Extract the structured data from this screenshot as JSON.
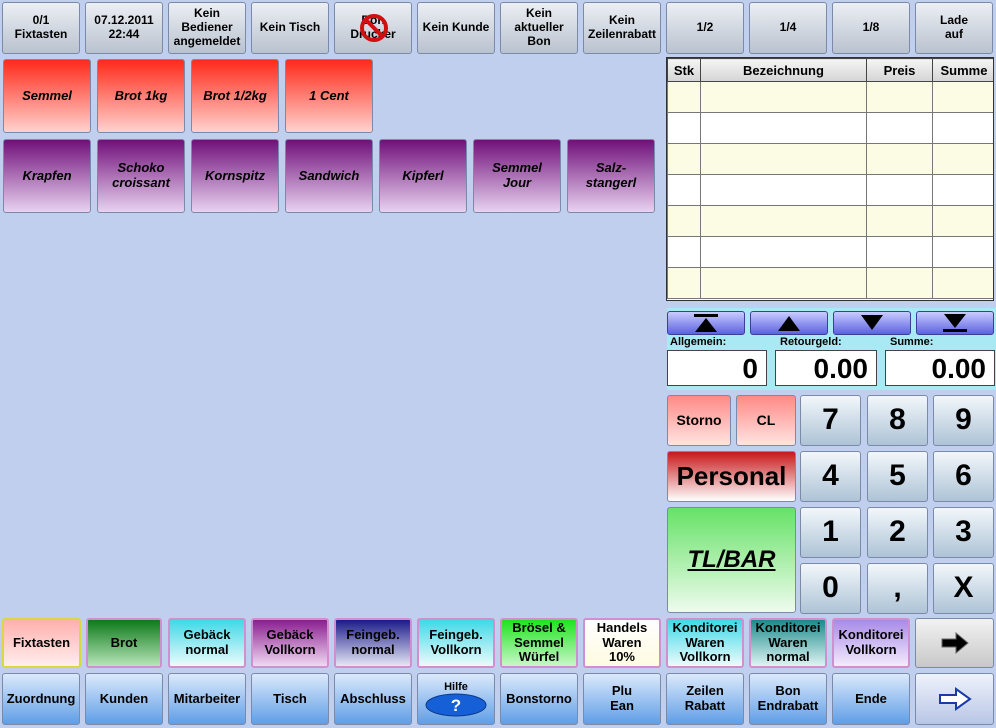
{
  "top_bar": {
    "fixtasten": "0/1\nFixtasten",
    "datetime": "07.12.2011\n22:44",
    "bediener": "Kein\nBediener\nangemeldet",
    "tisch": "Kein Tisch",
    "bon_drucker": "Bon\nDrucker",
    "kunde": "Kein Kunde",
    "aktueller_bon": "Kein\naktueller\nBon",
    "zeilenrabatt": "Kein\nZeilenrabatt",
    "half": "1/2",
    "quarter": "1/4",
    "eighth": "1/8",
    "lade": "Lade\nauf"
  },
  "products_row1": [
    "Semmel",
    "Brot 1kg",
    "Brot 1/2kg",
    "1 Cent"
  ],
  "products_row2": [
    "Krapfen",
    "Schoko\ncroissant",
    "Kornspitz",
    "Sandwich",
    "Kipferl",
    "Semmel\nJour",
    "Salz-\nstangerl"
  ],
  "receipt": {
    "headers": [
      "Stk",
      "Bezeichnung",
      "Preis",
      "Summe"
    ]
  },
  "totals": {
    "allgemein_label": "Allgemein:",
    "allgemein_value": "0",
    "retourgeld_label": "Retourgeld:",
    "retourgeld_value": "0.00",
    "summe_label": "Summe:",
    "summe_value": "0.00"
  },
  "keypad": {
    "storno": "Storno",
    "cl": "CL",
    "personal": "Personal",
    "tlbar": "TL/BAR",
    "k7": "7",
    "k8": "8",
    "k9": "9",
    "k4": "4",
    "k5": "5",
    "k6": "6",
    "k1": "1",
    "k2": "2",
    "k3": "3",
    "k0": "0",
    "comma": ",",
    "x": "X"
  },
  "categories": [
    "Fixtasten",
    "Brot",
    "Gebäck\nnormal",
    "Gebäck\nVollkorn",
    "Feingeb.\nnormal",
    "Feingeb.\nVollkorn",
    "Brösel &\nSemmel\nWürfel",
    "Handels\nWaren\n10%",
    "Konditorei\nWaren\nVollkorn",
    "Konditorei\nWaren\nnormal",
    "Konditorei\nVollkorn"
  ],
  "bottom_bar": {
    "zuordnung": "Zuordnung",
    "kunden": "Kunden",
    "mitarbeiter": "Mitarbeiter",
    "tisch": "Tisch",
    "abschluss": "Abschluss",
    "hilfe": "Hilfe",
    "bonstorno": "Bonstorno",
    "plu_ean": "Plu\nEan",
    "zeilen_rabatt": "Zeilen\nRabatt",
    "bon_endrabatt": "Bon\nEndrabatt",
    "ende": "Ende"
  },
  "colors": {
    "background": "#c0cfee",
    "product_red": "#ff2a1a",
    "product_purple": "#70107a"
  }
}
